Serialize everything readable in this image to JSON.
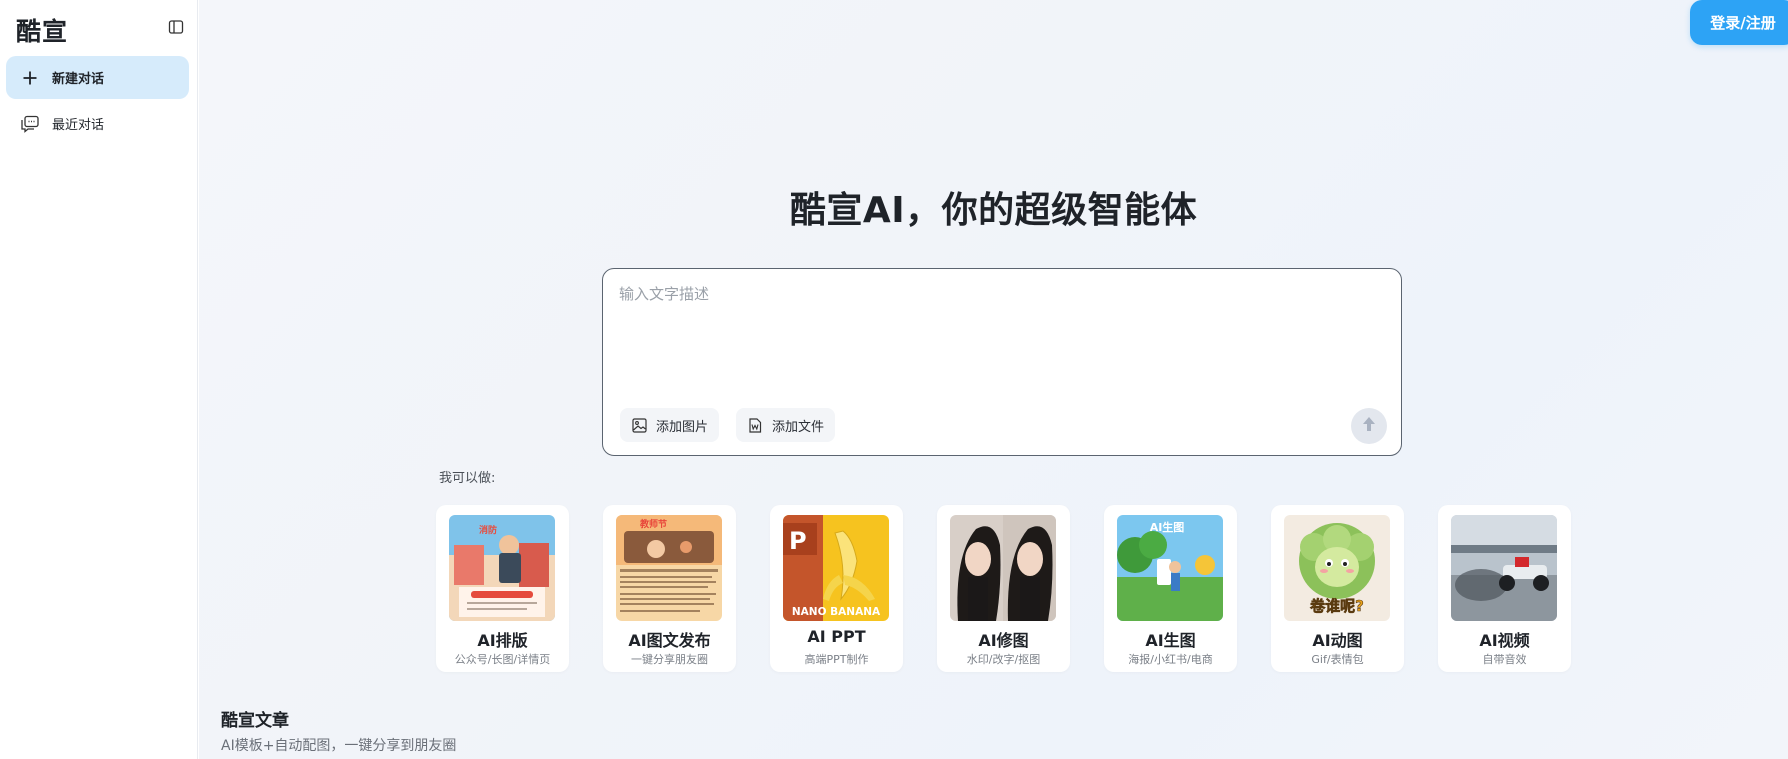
{
  "sidebar": {
    "brand": "酷宣",
    "items": [
      {
        "label": "新建对话",
        "icon": "plus-icon"
      },
      {
        "label": "最近对话",
        "icon": "chat-history-icon"
      }
    ]
  },
  "header": {
    "login_label": "登录/注册"
  },
  "hero": {
    "title": "酷宣AI，你的超级智能体"
  },
  "composer": {
    "placeholder": "输入文字描述",
    "add_image_label": "添加图片",
    "add_file_label": "添加文件"
  },
  "capabilities": {
    "heading": "我可以做:",
    "cards": [
      {
        "title": "AI排版",
        "subtitle": "公众号/长图/详情页"
      },
      {
        "title": "AI图文发布",
        "subtitle": "一键分享朋友圈"
      },
      {
        "title": "AI PPT",
        "subtitle": "高端PPT制作",
        "image_text": "NANO BANANA"
      },
      {
        "title": "AI修图",
        "subtitle": "水印/改字/抠图"
      },
      {
        "title": "AI生图",
        "subtitle": "海报/小红书/电商"
      },
      {
        "title": "AI动图",
        "subtitle": "Gif/表情包"
      },
      {
        "title": "AI视频",
        "subtitle": "自带音效"
      }
    ]
  },
  "articles": {
    "title": "酷宣文章",
    "subtitle": "AI模板+自动配图，一键分享到朋友圈"
  },
  "colors": {
    "accent": "#2da3f5",
    "active_nav": "#d6ebfb"
  }
}
